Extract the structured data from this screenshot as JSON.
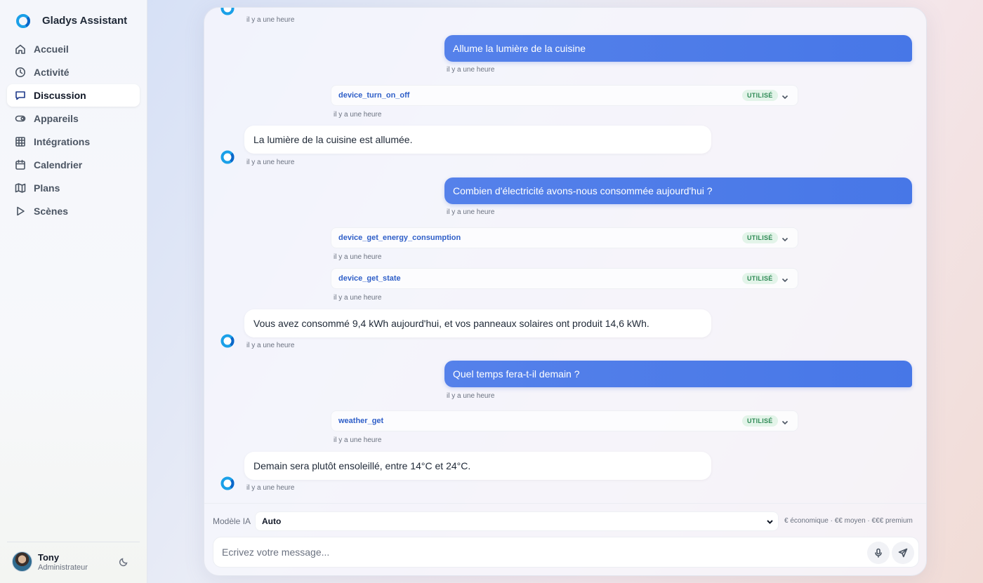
{
  "app": {
    "name": "Gladys Assistant"
  },
  "sidebar": {
    "items": [
      {
        "label": "Accueil",
        "icon": "home-icon"
      },
      {
        "label": "Activité",
        "icon": "clock-icon"
      },
      {
        "label": "Discussion",
        "icon": "chat-icon",
        "active": true
      },
      {
        "label": "Appareils",
        "icon": "toggle-icon"
      },
      {
        "label": "Intégrations",
        "icon": "grid-icon"
      },
      {
        "label": "Calendrier",
        "icon": "calendar-icon"
      },
      {
        "label": "Plans",
        "icon": "map-icon"
      },
      {
        "label": "Scènes",
        "icon": "play-icon"
      }
    ]
  },
  "user": {
    "name": "Tony",
    "role": "Administrateur"
  },
  "chat": {
    "top_timestamp": "il y a une heure",
    "messages": [
      {
        "type": "user",
        "text": "Allume la lumière de la cuisine",
        "time": "il y a une heure"
      },
      {
        "type": "tool",
        "name": "device_turn_on_off",
        "status": "UTILISÉ",
        "time": "il y a une heure"
      },
      {
        "type": "assistant",
        "text": "La lumière de la cuisine est allumée.",
        "time": "il y a une heure"
      },
      {
        "type": "user",
        "text": "Combien d'électricité avons-nous consommée aujourd'hui ?",
        "time": "il y a une heure"
      },
      {
        "type": "tool",
        "name": "device_get_energy_consumption",
        "status": "UTILISÉ",
        "time": "il y a une heure"
      },
      {
        "type": "tool",
        "name": "device_get_state",
        "status": "UTILISÉ",
        "time": "il y a une heure"
      },
      {
        "type": "assistant",
        "text": "Vous avez consommé 9,4 kWh aujourd'hui, et vos panneaux solaires ont produit 14,6 kWh.",
        "time": "il y a une heure"
      },
      {
        "type": "user",
        "text": "Quel temps fera-t-il demain ?",
        "time": "il y a une heure"
      },
      {
        "type": "tool",
        "name": "weather_get",
        "status": "UTILISÉ",
        "time": "il y a une heure"
      },
      {
        "type": "assistant",
        "text": "Demain sera plutôt ensoleillé, entre 14°C et 24°C.",
        "time": "il y a une heure"
      }
    ]
  },
  "footer": {
    "model_label": "Modèle IA",
    "model_value": "Auto",
    "pricing": "€ économique · €€ moyen · €€€ premium",
    "placeholder": "Ecrivez votre message..."
  },
  "colors": {
    "accent": "#4f7ce8",
    "badge_bg": "#e3f4e9",
    "badge_text": "#2e8a55",
    "tool_name": "#2f5fc8"
  }
}
